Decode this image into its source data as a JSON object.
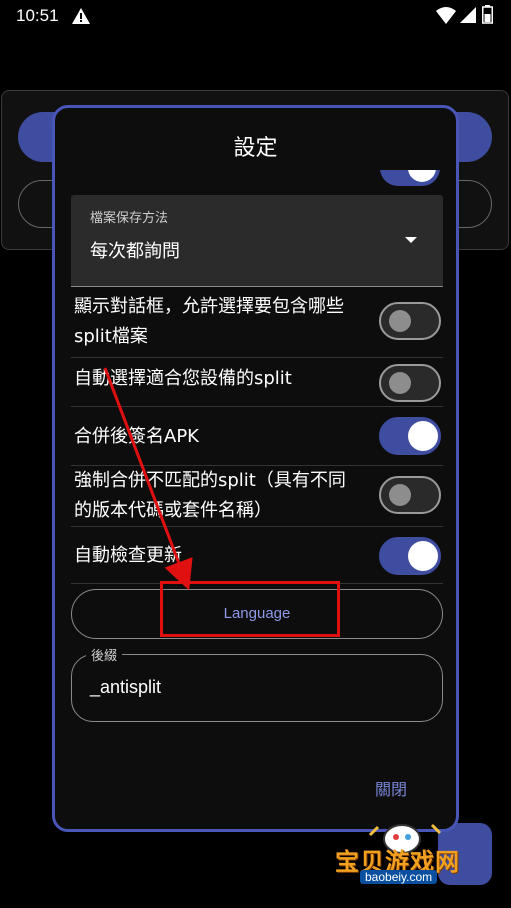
{
  "status_bar": {
    "time": "10:51"
  },
  "dialog": {
    "title": "設定",
    "dropdown": {
      "label": "檔案保存方法",
      "value": "每次都詢問"
    },
    "settings": [
      {
        "label": "顯示對話框，允許選擇要包含哪些split檔案",
        "enabled": false
      },
      {
        "label": "自動選擇適合您設備的split",
        "enabled": false
      },
      {
        "label": "合併後簽名APK",
        "enabled": true
      },
      {
        "label": "強制合併不匹配的split（具有不同的版本代碼或套件名稱）",
        "enabled": false
      },
      {
        "label": "自動檢查更新",
        "enabled": true
      }
    ],
    "language_button": "Language",
    "suffix": {
      "label": "後綴",
      "value": "_antisplit"
    },
    "close_button": "關閉"
  },
  "watermark": {
    "text": "宝贝游戏网",
    "url": "baobeiy.com"
  },
  "colors": {
    "accent": "#3f4da0",
    "dialog_border": "#4a55b8",
    "annotation": "#e01010"
  }
}
